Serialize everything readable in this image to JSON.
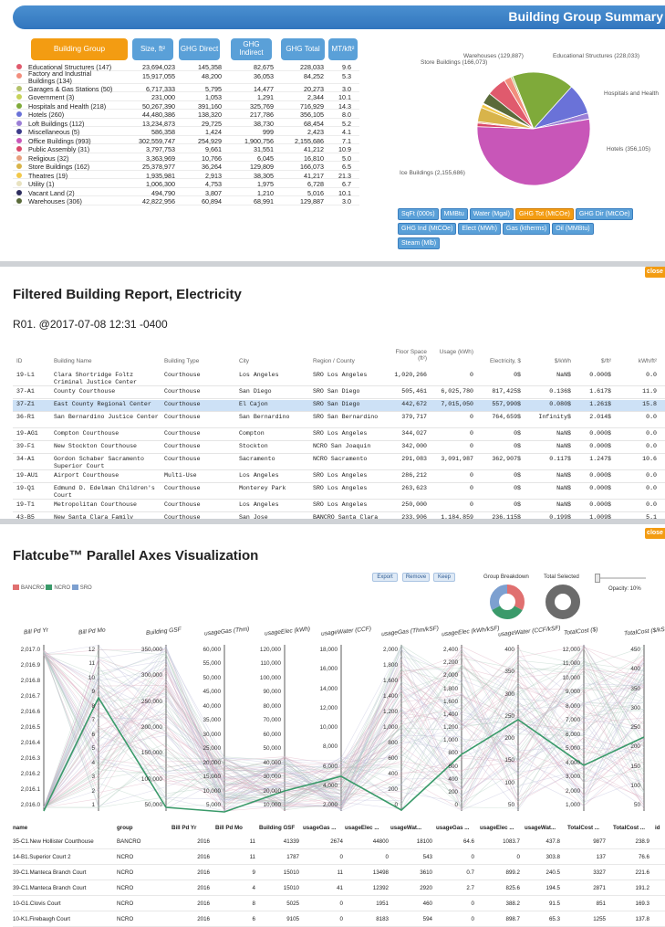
{
  "summary": {
    "title": "Building Group Summary",
    "headers": [
      "Building Group",
      "Size, ft²",
      "GHG Direct",
      "GHG Indirect",
      "GHG Total",
      "MT/kft²"
    ],
    "rows": [
      {
        "name": "Educational Structures (147)",
        "color": "#e05a6d",
        "size": "23,694,023",
        "direct": "145,358",
        "indirect": "82,675",
        "total": "228,033",
        "mt": "9.6"
      },
      {
        "name": "Factory and Industrial Buildings (134)",
        "color": "#f28e7d",
        "size": "15,917,055",
        "direct": "48,200",
        "indirect": "36,053",
        "total": "84,252",
        "mt": "5.3"
      },
      {
        "name": "Garages & Gas Stations (50)",
        "color": "#b3c26a",
        "size": "6,717,333",
        "direct": "5,795",
        "indirect": "14,477",
        "total": "20,273",
        "mt": "3.0"
      },
      {
        "name": "Government (3)",
        "color": "#c7d35a",
        "size": "231,000",
        "direct": "1,053",
        "indirect": "1,291",
        "total": "2,344",
        "mt": "10.1"
      },
      {
        "name": "Hospitals and Health (218)",
        "color": "#7faa3a",
        "size": "50,267,390",
        "direct": "391,160",
        "indirect": "325,769",
        "total": "716,929",
        "mt": "14.3"
      },
      {
        "name": "Hotels (260)",
        "color": "#6a72d8",
        "size": "44,480,386",
        "direct": "138,320",
        "indirect": "217,786",
        "total": "356,105",
        "mt": "8.0"
      },
      {
        "name": "Loft Buildings (112)",
        "color": "#9b7fd6",
        "size": "13,234,873",
        "direct": "29,725",
        "indirect": "38,730",
        "total": "68,454",
        "mt": "5.2"
      },
      {
        "name": "Miscellaneous (5)",
        "color": "#3c3c8a",
        "size": "586,358",
        "direct": "1,424",
        "indirect": "999",
        "total": "2,423",
        "mt": "4.1"
      },
      {
        "name": "Office Buildings (993)",
        "color": "#c856b8",
        "size": "302,559,747",
        "direct": "254,929",
        "indirect": "1,900,756",
        "total": "2,155,686",
        "mt": "7.1"
      },
      {
        "name": "Public Assembly (31)",
        "color": "#d9486a",
        "size": "3,797,753",
        "direct": "9,661",
        "indirect": "31,551",
        "total": "41,212",
        "mt": "10.9"
      },
      {
        "name": "Religious (32)",
        "color": "#e8a07e",
        "size": "3,363,969",
        "direct": "10,766",
        "indirect": "6,045",
        "total": "16,810",
        "mt": "5.0"
      },
      {
        "name": "Store Buildings (162)",
        "color": "#d8b44a",
        "size": "25,378,977",
        "direct": "36,264",
        "indirect": "129,809",
        "total": "166,073",
        "mt": "6.5"
      },
      {
        "name": "Theatres (19)",
        "color": "#f2c84a",
        "size": "1,935,981",
        "direct": "2,913",
        "indirect": "38,305",
        "total": "41,217",
        "mt": "21.3"
      },
      {
        "name": "Utility (1)",
        "color": "#e8e2c0",
        "size": "1,006,300",
        "direct": "4,753",
        "indirect": "1,975",
        "total": "6,728",
        "mt": "6.7"
      },
      {
        "name": "Vacant Land (2)",
        "color": "#2e2e5e",
        "size": "494,790",
        "direct": "3,807",
        "indirect": "1,210",
        "total": "5,016",
        "mt": "10.1"
      },
      {
        "name": "Warehouses (306)",
        "color": "#5a6a3a",
        "size": "42,822,956",
        "direct": "60,894",
        "indirect": "68,991",
        "total": "129,887",
        "mt": "3.0"
      }
    ],
    "pie_labels": [
      "Warehouses (129,887)",
      "Store Buildings (166,073)",
      "Educational Structures (228,033)",
      "Hospitals and Health",
      "Hotels (356,105)",
      "Ice Buildings (2,155,686)"
    ],
    "metric_buttons": [
      "SqFt (000s)",
      "MMBtu",
      "Water (Mgal)",
      "GHG Tot (MtCOe)",
      "GHG Dir (MtCOe)",
      "GHG Ind (MtCOe)",
      "Elect (MWh)",
      "Gas (ktherms)",
      "Oil (MMBtu)",
      "Steam (Mlb)"
    ],
    "active_button": "GHG Tot (MtCOe)"
  },
  "report": {
    "close": "close",
    "title": "Filtered Building Report, Electricity",
    "subtitle": "R01. @2017-07-08 12:31 -0400",
    "headers": [
      "ID",
      "Building Name",
      "Building Type",
      "City",
      "Region / County",
      "Floor Space (ft²)",
      "Usage (kWh)",
      "Electricity, $",
      "$/kWh",
      "$/ft²",
      "kWh/ft²"
    ],
    "rows": [
      [
        "19-L1",
        "Clara Shortridge Foltz Criminal Justice Center",
        "Courthouse",
        "Los Angeles",
        "SRO Los Angeles",
        "1,020,266",
        "0",
        "0$",
        "NaN$",
        "0.000$",
        "0.0"
      ],
      [
        "37-A1",
        "County Courthouse",
        "Courthouse",
        "San Diego",
        "SRO San Diego",
        "505,461",
        "6,025,780",
        "817,425$",
        "0.136$",
        "1.617$",
        "11.9"
      ],
      [
        "37-Z1",
        "East County Regional Center",
        "Courthouse",
        "El Cajon",
        "SRO San Diego",
        "442,672",
        "7,015,050",
        "557,990$",
        "0.080$",
        "1.261$",
        "15.8"
      ],
      [
        "36-R1",
        "San Bernardino Justice Center",
        "Courthouse",
        "San Bernardino",
        "SRO San Bernardino",
        "379,717",
        "0",
        "764,659$",
        "Infinity$",
        "2.014$",
        "0.0"
      ],
      [
        "19-AG1",
        "Compton Courthouse",
        "Courthouse",
        "Compton",
        "SRO Los Angeles",
        "344,027",
        "0",
        "0$",
        "NaN$",
        "0.000$",
        "0.0"
      ],
      [
        "39-F1",
        "New Stockton Courthouse",
        "Courthouse",
        "Stockton",
        "NCRO San Joaquin",
        "342,000",
        "0",
        "0$",
        "NaN$",
        "0.000$",
        "0.0"
      ],
      [
        "34-A1",
        "Gordon Schaber Sacramento Superior Court",
        "Courthouse",
        "Sacramento",
        "NCRO Sacramento",
        "291,083",
        "3,091,987",
        "362,907$",
        "0.117$",
        "1.247$",
        "10.6"
      ],
      [
        "19-AU1",
        "Airport Courthouse",
        "Multi-Use",
        "Los Angeles",
        "SRO Los Angeles",
        "286,212",
        "0",
        "0$",
        "NaN$",
        "0.000$",
        "0.0"
      ],
      [
        "19-Q1",
        "Edmund D. Edelman Children's Court",
        "Courthouse",
        "Monterey Park",
        "SRO Los Angeles",
        "263,623",
        "0",
        "0$",
        "NaN$",
        "0.000$",
        "0.0"
      ],
      [
        "19-T1",
        "Metropolitan Courthouse",
        "Courthouse",
        "Los Angeles",
        "SRO Los Angeles",
        "250,000",
        "0",
        "0$",
        "NaN$",
        "0.000$",
        "0.0"
      ],
      [
        "43-B5",
        "New Santa Clara Family Justice Center",
        "Courthouse",
        "San Jose",
        "BANCRO Santa Clara",
        "233,906",
        "1,184,859",
        "236,115$",
        "0.199$",
        "1.009$",
        "5.1"
      ]
    ],
    "selected_row": 2
  },
  "parallel": {
    "close": "close",
    "title": "Flatcube™ Parallel Axes Visualization",
    "buttons": [
      "Export",
      "Remove",
      "Keep"
    ],
    "legend": [
      {
        "name": "BANCRO",
        "color": "#e07070"
      },
      {
        "name": "NCRO",
        "color": "#3a9a6a"
      },
      {
        "name": "SRO",
        "color": "#7da0d0"
      }
    ],
    "group_breakdown": "Group Breakdown",
    "total_selected": "Total Selected",
    "opacity": "Opacity: 10%",
    "axes": [
      {
        "title": "Bill Pd Yr",
        "ticks": [
          "2,017.0",
          "2,016.9",
          "2,016.8",
          "2,016.7",
          "2,016.6",
          "2,016.5",
          "2,016.4",
          "2,016.3",
          "2,016.2",
          "2,016.1",
          "2,016.0"
        ]
      },
      {
        "title": "Bill Pd Mo",
        "ticks": [
          "12",
          "11",
          "10",
          "9",
          "8",
          "7",
          "6",
          "5",
          "4",
          "3",
          "2",
          "1"
        ]
      },
      {
        "title": "Building GSF",
        "ticks": [
          "350,000",
          "300,000",
          "250,000",
          "200,000",
          "150,000",
          "100,000",
          "50,000"
        ]
      },
      {
        "title": "usageGas (Thm)",
        "ticks": [
          "60,000",
          "55,000",
          "50,000",
          "45,000",
          "40,000",
          "35,000",
          "30,000",
          "25,000",
          "20,000",
          "15,000",
          "10,000",
          "5,000"
        ]
      },
      {
        "title": "usageElec (kWh)",
        "ticks": [
          "120,000",
          "110,000",
          "100,000",
          "90,000",
          "80,000",
          "70,000",
          "60,000",
          "50,000",
          "40,000",
          "30,000",
          "20,000",
          "10,000"
        ]
      },
      {
        "title": "usageWater (CCF)",
        "ticks": [
          "18,000",
          "16,000",
          "14,000",
          "12,000",
          "10,000",
          "8,000",
          "6,000",
          "4,000",
          "2,000"
        ]
      },
      {
        "title": "usageGas (Thm/kSF)",
        "ticks": [
          "2,000",
          "1,800",
          "1,600",
          "1,400",
          "1,200",
          "1,000",
          "800",
          "600",
          "400",
          "200",
          "0"
        ]
      },
      {
        "title": "usageElec (kWh/kSF)",
        "ticks": [
          "2,400",
          "2,200",
          "2,000",
          "1,800",
          "1,600",
          "1,400",
          "1,200",
          "1,000",
          "800",
          "600",
          "400",
          "200",
          "0"
        ]
      },
      {
        "title": "usageWater (CCF/kSF)",
        "ticks": [
          "400",
          "350",
          "300",
          "250",
          "200",
          "150",
          "100",
          "50"
        ]
      },
      {
        "title": "TotalCost ($)",
        "ticks": [
          "12,000",
          "11,000",
          "10,000",
          "9,000",
          "8,000",
          "7,000",
          "6,000",
          "5,000",
          "4,000",
          "3,000",
          "2,000",
          "1,000"
        ]
      },
      {
        "title": "TotalCost ($/kSF)",
        "ticks": [
          "450",
          "400",
          "350",
          "300",
          "250",
          "200",
          "150",
          "100",
          "50"
        ]
      }
    ],
    "table_headers": [
      "name",
      "group",
      "Bill Pd Yr",
      "Bill Pd Mo",
      "Building GSF",
      "usageGas ...",
      "usageElec ...",
      "usageWat...",
      "usageGas ...",
      "usageElec ...",
      "usageWat...",
      "TotalCost ...",
      "TotalCost ...",
      "id"
    ],
    "table_rows": [
      [
        "35-C1.New Hollister Courthouse",
        "BANCRO",
        "2016",
        "11",
        "41339",
        "2674",
        "44800",
        "18100",
        "64.6",
        "1083.7",
        "437.8",
        "9877",
        "238.9"
      ],
      [
        "14-B1.Superior Court 2",
        "NCRO",
        "2016",
        "11",
        "1787",
        "0",
        "0",
        "543",
        "0",
        "0",
        "303.8",
        "137",
        "76.6"
      ],
      [
        "39-C1.Manteca Branch Court",
        "NCRO",
        "2016",
        "9",
        "15010",
        "11",
        "13498",
        "3610",
        "0.7",
        "899.2",
        "240.5",
        "3327",
        "221.6"
      ],
      [
        "39-C1.Manteca Branch Court",
        "NCRO",
        "2016",
        "4",
        "15010",
        "41",
        "12392",
        "2920",
        "2.7",
        "825.6",
        "194.5",
        "2871",
        "191.2"
      ],
      [
        "10-G1.Clovis Court",
        "NCRO",
        "2016",
        "8",
        "5025",
        "0",
        "1951",
        "460",
        "0",
        "388.2",
        "91.5",
        "851",
        "169.3"
      ],
      [
        "10-K1.Firebaugh Court",
        "NCRO",
        "2016",
        "6",
        "9105",
        "0",
        "8183",
        "594",
        "0",
        "898.7",
        "65.3",
        "1255",
        "137.8"
      ]
    ]
  }
}
